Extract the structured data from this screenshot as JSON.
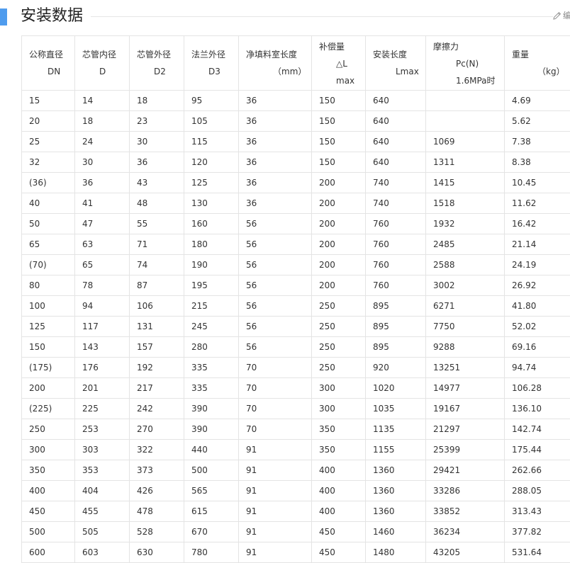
{
  "section": {
    "title": "安装数据",
    "edit_label": "编"
  },
  "table": {
    "headers": [
      {
        "line1": "公称直径",
        "line2": "DN"
      },
      {
        "line1": "芯管内径",
        "line2": "D"
      },
      {
        "line1": "芯管外径",
        "line2": "D2"
      },
      {
        "line1": "法兰外径",
        "line2": "D3"
      },
      {
        "line1": "净填料室长度",
        "line2": "（mm）"
      },
      {
        "line1": "补偿量",
        "line2": "△L",
        "line3": "max"
      },
      {
        "line1": "安装长度",
        "line2": "Lmax"
      },
      {
        "line1": "摩擦力",
        "line2": "Pc(N)",
        "line3": "1.6MPa时"
      },
      {
        "line1": "重量",
        "line2": "（kg）"
      }
    ],
    "rows": [
      [
        "15",
        "14",
        "18",
        "95",
        "36",
        "150",
        "640",
        "",
        "4.69"
      ],
      [
        "20",
        "18",
        "23",
        "105",
        "36",
        "150",
        "640",
        "",
        "5.62"
      ],
      [
        "25",
        "24",
        "30",
        "115",
        "36",
        "150",
        "640",
        "1069",
        "7.38"
      ],
      [
        "32",
        "30",
        "36",
        "120",
        "36",
        "150",
        "640",
        "1311",
        "8.38"
      ],
      [
        "(36)",
        "36",
        "43",
        "125",
        "36",
        "200",
        "740",
        "1415",
        "10.45"
      ],
      [
        "40",
        "41",
        "48",
        "130",
        "36",
        "200",
        "740",
        "1518",
        "11.62"
      ],
      [
        "50",
        "47",
        "55",
        "160",
        "56",
        "200",
        "760",
        "1932",
        "16.42"
      ],
      [
        "65",
        "63",
        "71",
        "180",
        "56",
        "200",
        "760",
        "2485",
        "21.14"
      ],
      [
        "(70)",
        "65",
        "74",
        "190",
        "56",
        "200",
        "760",
        "2588",
        "24.19"
      ],
      [
        "80",
        "78",
        "87",
        "195",
        "56",
        "200",
        "760",
        "3002",
        "26.92"
      ],
      [
        "100",
        "94",
        "106",
        "215",
        "56",
        "250",
        "895",
        "6271",
        "41.80"
      ],
      [
        "125",
        "117",
        "131",
        "245",
        "56",
        "250",
        "895",
        "7750",
        "52.02"
      ],
      [
        "150",
        "143",
        "157",
        "280",
        "56",
        "250",
        "895",
        "9288",
        "69.16"
      ],
      [
        "(175)",
        "176",
        "192",
        "335",
        "70",
        "250",
        "920",
        "13251",
        "94.74"
      ],
      [
        "200",
        "201",
        "217",
        "335",
        "70",
        "300",
        "1020",
        "14977",
        "106.28"
      ],
      [
        "(225)",
        "225",
        "242",
        "390",
        "70",
        "300",
        "1035",
        "19167",
        "136.10"
      ],
      [
        "250",
        "253",
        "270",
        "390",
        "70",
        "350",
        "1135",
        "21297",
        "142.74"
      ],
      [
        "300",
        "303",
        "322",
        "440",
        "91",
        "350",
        "1155",
        "25399",
        "175.44"
      ],
      [
        "350",
        "353",
        "373",
        "500",
        "91",
        "400",
        "1360",
        "29421",
        "262.66"
      ],
      [
        "400",
        "404",
        "426",
        "565",
        "91",
        "400",
        "1360",
        "33286",
        "288.05"
      ],
      [
        "450",
        "455",
        "478",
        "615",
        "91",
        "400",
        "1360",
        "33852",
        "313.43"
      ],
      [
        "500",
        "505",
        "528",
        "670",
        "91",
        "450",
        "1460",
        "36234",
        "377.82"
      ],
      [
        "600",
        "603",
        "630",
        "780",
        "91",
        "450",
        "1480",
        "43205",
        "531.64"
      ]
    ]
  },
  "colors": {
    "accent": "#4f9cee",
    "border": "#e4e4e4",
    "text": "#333333"
  },
  "icons": {
    "edit": "pencil-icon"
  }
}
